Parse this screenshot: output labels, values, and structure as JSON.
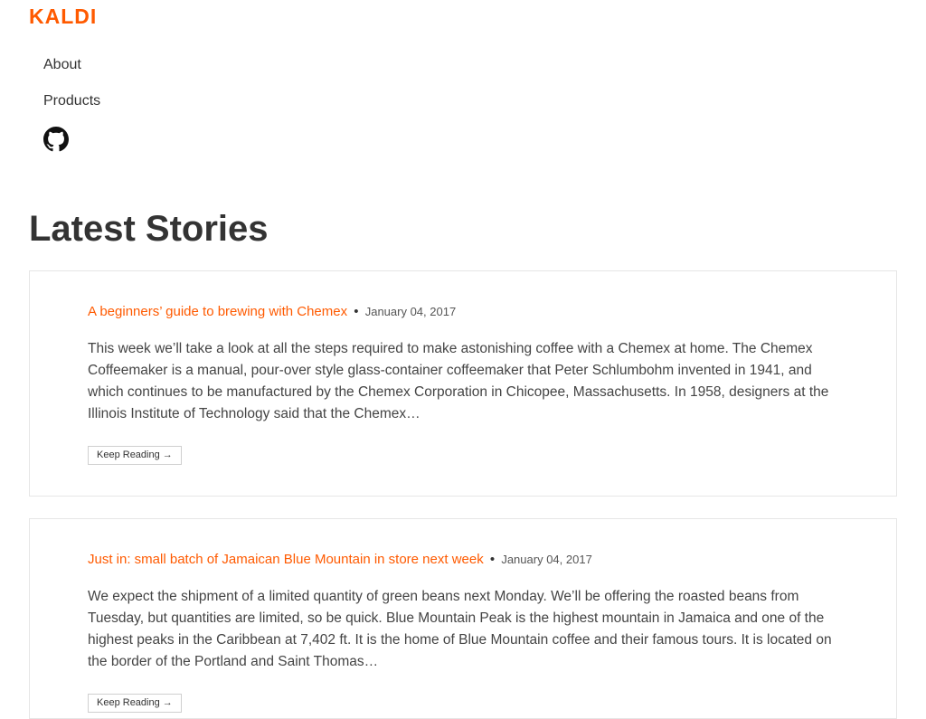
{
  "header": {
    "logo": "KALDI"
  },
  "nav": {
    "items": [
      {
        "label": "About"
      },
      {
        "label": "Products"
      }
    ],
    "github_icon": "github-icon"
  },
  "page": {
    "title": "Latest Stories"
  },
  "stories": [
    {
      "title": "A beginners’ guide to brewing with Chemex",
      "separator": "•",
      "date": "January 04, 2017",
      "excerpt": "This week we’ll take a look at all the steps required to make astonishing coffee with a Chemex at home. The Chemex Coffeemaker is a manual, pour-over style glass-container coffeemaker that Peter Schlumbohm invented in 1941, and which continues to be manufactured by the Chemex Corporation in Chicopee, Massachusetts. In 1958, designers at the Illinois Institute of Technology said that the Chemex…",
      "cta": "Keep Reading →"
    },
    {
      "title": "Just in: small batch of Jamaican Blue Mountain in store next week",
      "separator": "•",
      "date": "January 04, 2017",
      "excerpt": "We expect the shipment of a limited quantity of green beans next Monday. We’ll be offering the roasted beans from Tuesday, but quantities are limited, so be quick. Blue Mountain Peak is the highest mountain in Jamaica and one of the highest peaks in the Caribbean at 7,402 ft. It is the home of Blue Mountain coffee and their famous tours. It is located on the border of the Portland and Saint Thomas…",
      "cta": "Keep Reading →"
    }
  ],
  "colors": {
    "accent": "#ff5a00",
    "text": "#333333",
    "border": "#e6e6e6"
  }
}
